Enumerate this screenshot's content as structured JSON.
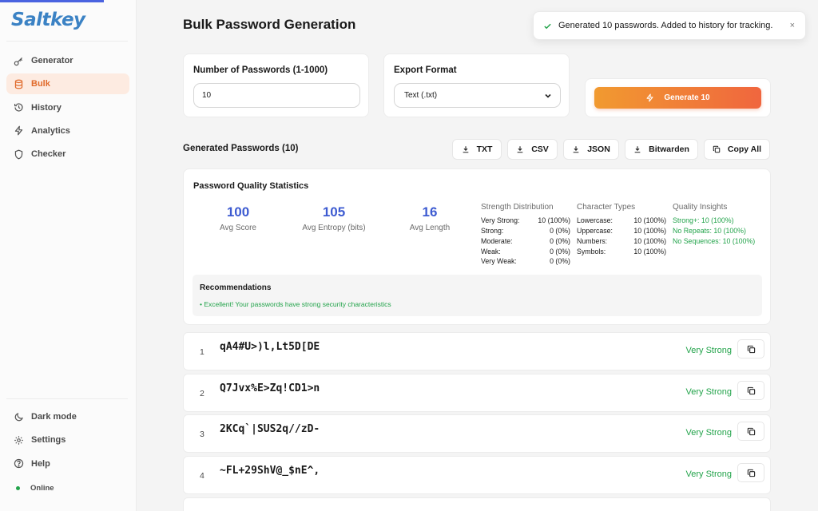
{
  "brand": {
    "name": "Saltkey",
    "accent": "#e06a2a",
    "logo_color": "#3b82c4"
  },
  "sidebar": {
    "items": [
      {
        "label": "Generator",
        "icon": "key-icon",
        "active": false
      },
      {
        "label": "Bulk",
        "icon": "database-icon",
        "active": true
      },
      {
        "label": "History",
        "icon": "history-icon",
        "active": false
      },
      {
        "label": "Analytics",
        "icon": "bolt-icon",
        "active": false
      },
      {
        "label": "Checker",
        "icon": "shield-icon",
        "active": false
      }
    ],
    "bottom": [
      {
        "label": "Dark mode",
        "icon": "moon-icon"
      },
      {
        "label": "Settings",
        "icon": "gear-icon"
      },
      {
        "label": "Help",
        "icon": "help-icon"
      }
    ],
    "status": "Online"
  },
  "page": {
    "title": "Bulk Password Generation"
  },
  "form": {
    "count_label": "Number of Passwords (1-1000)",
    "count_value": "10",
    "format_label": "Export Format",
    "format_value": "Text (.txt)",
    "generate_label": "Generate 10"
  },
  "results": {
    "title": "Generated Passwords (10)",
    "export_buttons": [
      "TXT",
      "CSV",
      "JSON",
      "Bitwarden",
      "Copy All"
    ]
  },
  "stats": {
    "title": "Password Quality Statistics",
    "avg_score": {
      "value": "100",
      "label": "Avg Score"
    },
    "avg_entropy": {
      "value": "105",
      "label": "Avg Entropy (bits)"
    },
    "avg_length": {
      "value": "16",
      "label": "Avg Length"
    },
    "strength": {
      "title": "Strength Distribution",
      "rows": [
        {
          "label": "Very Strong:",
          "value": "10 (100%)"
        },
        {
          "label": "Strong:",
          "value": "0 (0%)"
        },
        {
          "label": "Moderate:",
          "value": "0 (0%)"
        },
        {
          "label": "Weak:",
          "value": "0 (0%)"
        },
        {
          "label": "Very Weak:",
          "value": "0 (0%)"
        }
      ]
    },
    "char_types": {
      "title": "Character Types",
      "rows": [
        {
          "label": "Lowercase:",
          "value": "10 (100%)"
        },
        {
          "label": "Uppercase:",
          "value": "10 (100%)"
        },
        {
          "label": "Numbers:",
          "value": "10 (100%)"
        },
        {
          "label": "Symbols:",
          "value": "10 (100%)"
        }
      ]
    },
    "insights": {
      "title": "Quality Insights",
      "rows": [
        "Strong+: 10 (100%)",
        "No Repeats: 10 (100%)",
        "No Sequences: 10 (100%)"
      ]
    },
    "recommendations": {
      "title": "Recommendations",
      "items": [
        "• Excellent! Your passwords have strong security characteristics"
      ]
    }
  },
  "passwords": [
    {
      "index": "1",
      "value": "qA4#U>)l,Lt5D[DE",
      "strength": "Very Strong"
    },
    {
      "index": "2",
      "value": "Q7Jvx%E>Zq!CD1>n",
      "strength": "Very Strong"
    },
    {
      "index": "3",
      "value": "2KCq`|SUS2q//zD-",
      "strength": "Very Strong"
    },
    {
      "index": "4",
      "value": "~FL+29ShV@_$nE^,",
      "strength": "Very Strong"
    }
  ],
  "toast": {
    "message": "Generated 10 passwords. Added to history for tracking.",
    "close": "×"
  }
}
